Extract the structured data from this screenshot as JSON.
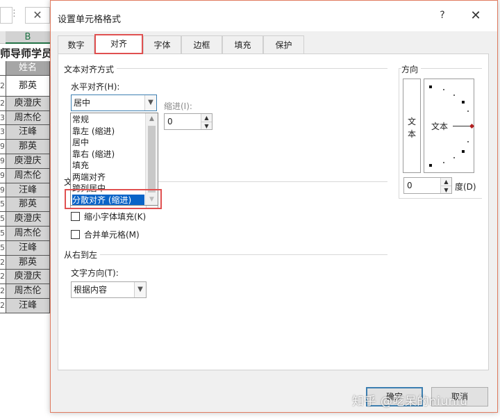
{
  "sheet": {
    "formula_x": "✕",
    "column_letter": "B",
    "title_fragment": "师导师学员",
    "header": "姓名",
    "rows": [
      {
        "num": "2",
        "name": "那英"
      },
      {
        "num": "2",
        "name": "庾澄庆"
      },
      {
        "num": "3",
        "name": "周杰伦"
      },
      {
        "num": "3",
        "name": "汪峰"
      },
      {
        "num": "9",
        "name": "那英"
      },
      {
        "num": "9",
        "name": "庾澄庆"
      },
      {
        "num": "9",
        "name": "周杰伦"
      },
      {
        "num": "9",
        "name": "汪峰"
      },
      {
        "num": "5",
        "name": "那英"
      },
      {
        "num": "5",
        "name": "庾澄庆"
      },
      {
        "num": "5",
        "name": "周杰伦"
      },
      {
        "num": "5",
        "name": "汪峰"
      },
      {
        "num": "2",
        "name": "那英"
      },
      {
        "num": "2",
        "name": "庾澄庆"
      },
      {
        "num": "2",
        "name": "周杰伦"
      },
      {
        "num": "2",
        "name": "汪峰"
      }
    ]
  },
  "dialog": {
    "title": "设置单元格格式",
    "help_label": "?",
    "close_label": "✕",
    "tabs": [
      "数字",
      "对齐",
      "字体",
      "边框",
      "填充",
      "保护"
    ],
    "active_tab": "对齐",
    "text_align_group": "文本对齐方式",
    "horizontal_label": "水平对齐(H):",
    "horizontal_value": "居中",
    "indent_label": "缩进(I):",
    "indent_value": "0",
    "dropdown_options": [
      "常规",
      "靠左 (缩进)",
      "居中",
      "靠右 (缩进)",
      "填充",
      "两端对齐",
      "跨列居中",
      "分散对齐 (缩进)"
    ],
    "dropdown_selected": "分散对齐 (缩进)",
    "text_control_fragment": "文",
    "shrink_label": "缩小字体填充(K)",
    "merge_label": "合并单元格(M)",
    "rtl_group": "从右到左",
    "text_direction_label": "文字方向(T):",
    "text_direction_value": "根据内容",
    "orientation_group": "方向",
    "vertical_text": [
      "文",
      "本"
    ],
    "dial_text": "文本",
    "degrees_value": "0",
    "degrees_label": "度(D)",
    "ok_label": "确定",
    "cancel_label": "取消"
  },
  "watermark": "知乎 @吃呆的niuniu",
  "colors": {
    "highlight_border": "#e05050",
    "selection_blue": "#0a64c8",
    "excel_green": "#217346",
    "header_gray": "#a6a6a6"
  }
}
